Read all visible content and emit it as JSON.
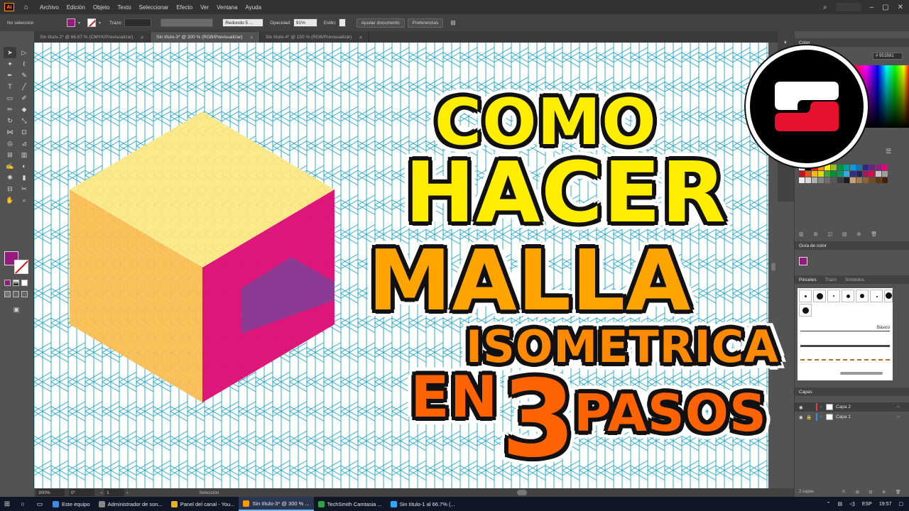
{
  "menubar": {
    "app_logo": "Ai",
    "items": [
      "Archivo",
      "Edición",
      "Objeto",
      "Texto",
      "Seleccionar",
      "Efecto",
      "Ver",
      "Ventana",
      "Ayuda"
    ]
  },
  "control": {
    "selection": "No selección",
    "stroke_label": "Trazo:",
    "brush_label": "Redondo 5 ...",
    "opacity_label": "Opacidad:",
    "opacity_value": "91%",
    "style_label": "Estilo:",
    "doc_button": "Ajustar documento",
    "prefs_button": "Preferencias"
  },
  "tabs": [
    {
      "label": "Sin título-2* @ 66.67 % (CMYK/Previsualizar)",
      "active": false
    },
    {
      "label": "Sin título-3* @ 300 % (RGB/Previsualizar)",
      "active": true
    },
    {
      "label": "Sin título-4* @ 150 % (RGB/Previsualizar)",
      "active": false
    }
  ],
  "status": {
    "zoom": "300%",
    "rotation": "0°",
    "artboard": "1",
    "mode": "Selección"
  },
  "title": {
    "line1": "COMO",
    "line2": "HACER",
    "line3": "MALLA",
    "line4": "ISOMETRICA",
    "line5a": "EN",
    "line5b": "3",
    "line5c": "PASOS"
  },
  "panels": {
    "color_tab": "Color",
    "color_hex": "951B81",
    "color_guide": "Guía de color",
    "brushes_tab": "Pinceles",
    "stroke_tab": "Trazo",
    "symbols_tab": "Símbolos",
    "brush_basic": "Básico",
    "layers_tab": "Capas",
    "layers": [
      {
        "name": "Capa 2",
        "bar_color": "#e0413c",
        "selected": true
      },
      {
        "name": "Capa 1",
        "bar_color": "#3c8be0",
        "selected": false
      }
    ],
    "layers_count": "2 capas"
  },
  "taskbar": {
    "tasks": [
      {
        "label": "Este equipo",
        "color": "#3d8ee0",
        "active": false
      },
      {
        "label": "Administrador de son...",
        "color": "#888888",
        "active": false
      },
      {
        "label": "Panel del canal - You...",
        "color": "#e8b31f",
        "active": false
      },
      {
        "label": "Sin título-3* @ 300 % ...",
        "color": "#ff9a00",
        "active": true
      },
      {
        "label": "TechSmith Camtasia ...",
        "color": "#2fa34c",
        "active": false
      },
      {
        "label": "Sin título-1 al 66.7% (...",
        "color": "#31a8ff",
        "active": false
      }
    ],
    "lang": "ESP",
    "time": "19:57"
  },
  "colors": {
    "fill": "#951b81",
    "grid": "#1aa3c2",
    "cube_top": "#fce98a",
    "cube_left": "#fbc15b",
    "cube_right": "#e0177a",
    "cube_inner": "#8e3a94"
  }
}
